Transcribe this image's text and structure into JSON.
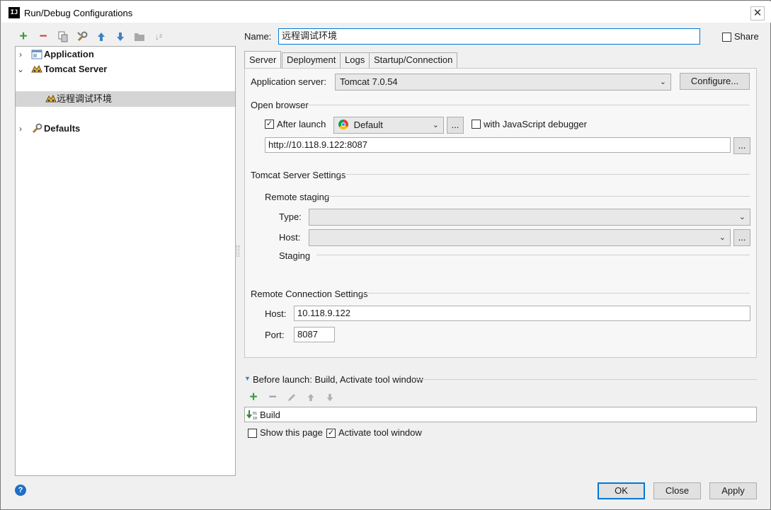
{
  "window": {
    "title": "Run/Debug Configurations",
    "app_icon_text": "IJ",
    "close_glyph": "✕"
  },
  "toolbar": {
    "icons": [
      "add-icon",
      "remove-icon",
      "copy-icon",
      "wrench-icon",
      "move-up-icon",
      "move-down-icon",
      "folder-icon",
      "sort-icon"
    ],
    "add_glyph": "+",
    "remove_glyph": "−",
    "up_glyph": "🡅",
    "down_glyph": "🡇",
    "sort_glyph": "↓ᶻ",
    "colors": {
      "add": "#3a9a3a",
      "remove": "#d43c3c",
      "arrow": "#3b82c4",
      "disabled": "#9a9a9a"
    }
  },
  "tree": {
    "items": [
      {
        "label": "Application",
        "expanded": false,
        "bold": true
      },
      {
        "label": "Tomcat Server",
        "expanded": true,
        "bold": true
      },
      {
        "label": "远程调试环境",
        "selected": true
      },
      {
        "label": "Defaults",
        "expanded": false,
        "bold": true
      }
    ],
    "chev_collapsed": "›",
    "chev_expanded": "⌄"
  },
  "name_field": {
    "label": "Name:",
    "value": "远程调试环境"
  },
  "share": {
    "label": "Share",
    "checked": false
  },
  "tabs": [
    {
      "label": "Server",
      "active": true
    },
    {
      "label": "Deployment",
      "active": false
    },
    {
      "label": "Logs",
      "active": false
    },
    {
      "label": "Startup/Connection",
      "active": false
    }
  ],
  "server": {
    "app_server_label": "Application server:",
    "app_server_value": "Tomcat 7.0.54",
    "configure_label": "Configure...",
    "open_browser_heading": "Open browser",
    "after_launch_label": "After launch",
    "after_launch_checked": true,
    "browser_value": "Default",
    "ellipsis": "...",
    "js_debugger_label": "with JavaScript debugger",
    "js_debugger_checked": false,
    "url_value": "http://10.118.9.122:8087",
    "tomcat_settings_heading": "Tomcat Server Settings",
    "remote_staging_heading": "Remote staging",
    "type_label": "Type:",
    "type_value": "",
    "host_label": "Host:",
    "host_value": "",
    "staging_label": "Staging",
    "remote_conn_heading": "Remote Connection Settings",
    "rc_host_label": "Host:",
    "rc_host_value": "10.118.9.122",
    "rc_port_label": "Port:",
    "rc_port_value": "8087"
  },
  "before_launch": {
    "heading": "Before launch: Build, Activate tool window",
    "tasks": [
      "Build"
    ],
    "show_page_label": "Show this page",
    "show_page_checked": false,
    "activate_label": "Activate tool window",
    "activate_checked": true,
    "toolbar_icons": [
      "add-icon",
      "remove-icon",
      "edit-icon",
      "move-up-icon",
      "move-down-icon"
    ]
  },
  "buttons": {
    "ok": "OK",
    "close": "Close",
    "apply": "Apply"
  },
  "help_glyph": "?",
  "check_glyph": "✓",
  "arrow_glyph": "⌄"
}
